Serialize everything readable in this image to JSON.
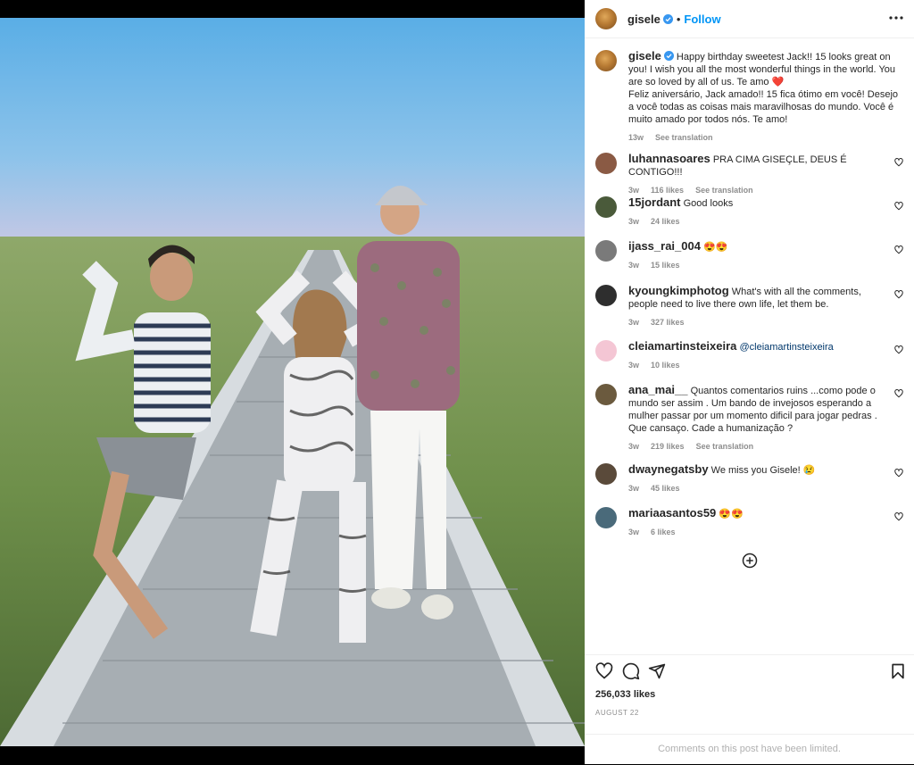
{
  "post": {
    "username": "gisele",
    "follow_label": "Follow",
    "dot": "•",
    "caption_user": "gisele",
    "caption_text": "Happy birthday sweetest Jack!! 15 looks great on you! I wish you all the most wonderful things in the world. You are so loved by all of us. Te amo ❤️",
    "caption_text_pt": "Feliz aniversário, Jack amado!! 15 fica ótimo em você! Desejo a você todas as coisas mais maravilhosas do mundo. Você é muito amado por todos nós. Te amo!",
    "caption_time": "13w",
    "caption_translate": "See translation",
    "likes": "256,033 likes",
    "date": "AUGUST 22",
    "limited": "Comments on this post have been limited."
  },
  "comments": [
    {
      "user": "luhannasoares",
      "text": "PRA CIMA GISEÇLE, DEUS É CONTIGO!!!",
      "time": "3w",
      "likes": "116 likes",
      "translate": "See translation",
      "avatar_color": "#8a5a44"
    },
    {
      "user": "15jordant",
      "text": "Good looks",
      "time": "3w",
      "likes": "24 likes",
      "translate": "",
      "avatar_color": "#4a5a3a"
    },
    {
      "user": "ijass_rai_004",
      "text": "😍😍",
      "time": "3w",
      "likes": "15 likes",
      "translate": "",
      "avatar_color": "#7a7a7a"
    },
    {
      "user": "kyoungkimphotog",
      "text": "What's with all the comments, people need to live there own life, let them be.",
      "time": "3w",
      "likes": "327 likes",
      "translate": "",
      "avatar_color": "#2e2e2e"
    },
    {
      "user": "cleiamartinsteixeira",
      "text": "@cleiamartinsteixeira",
      "time": "3w",
      "likes": "10 likes",
      "translate": "",
      "avatar_color": "#f4c6d4"
    },
    {
      "user": "ana_mai__",
      "text": "Quantos comentarios ruins ...como pode o mundo ser assim . Um bando de invejosos esperando a mulher passar por um momento dificil para jogar pedras . Que cansaço. Cade a humanização ?",
      "time": "3w",
      "likes": "219 likes",
      "translate": "See translation",
      "avatar_color": "#6b5a3e"
    },
    {
      "user": "dwaynegatsby",
      "text": "We miss you Gisele! 😢",
      "time": "3w",
      "likes": "45 likes",
      "translate": "",
      "avatar_color": "#5a4a3a"
    },
    {
      "user": "mariaasantos59",
      "text": "😍😍",
      "time": "3w",
      "likes": "6 likes",
      "translate": "",
      "avatar_color": "#4a6a7a"
    }
  ],
  "icons": {
    "verified": "verified-badge-icon",
    "more": "more-options-icon",
    "heart": "heart-icon",
    "comment": "comment-icon",
    "share": "share-icon",
    "save": "bookmark-icon",
    "add": "add-circle-icon"
  },
  "colors": {
    "accent": "#0095f6",
    "verified": "#3897f0",
    "muted": "#8e8e8e",
    "mention": "#00376b"
  }
}
